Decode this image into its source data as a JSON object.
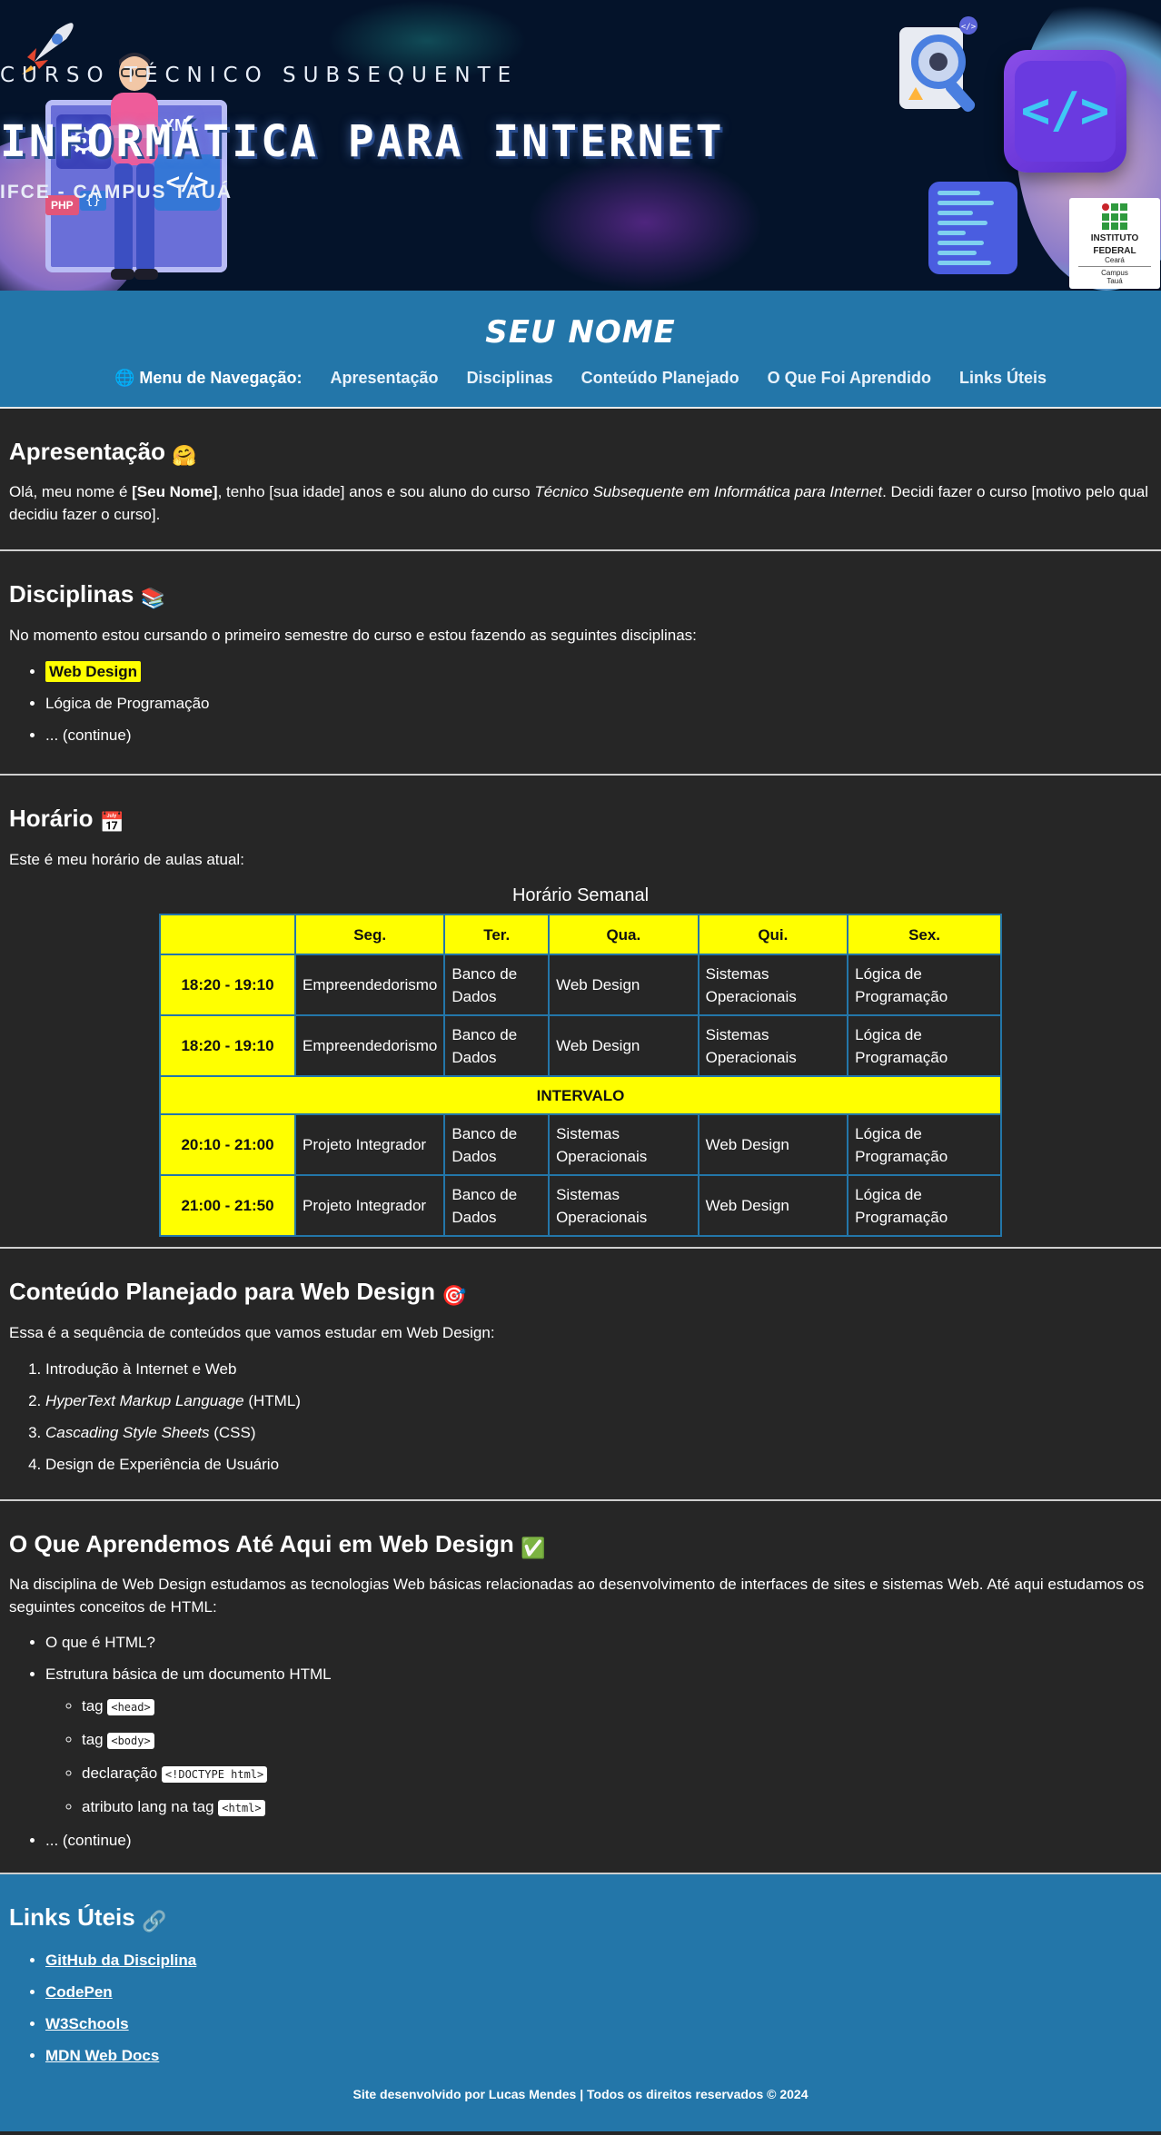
{
  "banner": {
    "kicker": "CURSO TÉCNICO SUBSEQUENTE",
    "title": "INFORMÁTICA PARA INTERNET",
    "subtitle": "IFCE - CAMPUS TAUÁ",
    "board_labels": {
      "xml": "XML",
      "php": "PHP",
      "braces": "{}",
      "code": "</>"
    },
    "logo": {
      "line1": "INSTITUTO",
      "line2": "FEDERAL",
      "line3": "Ceará",
      "line4": "Campus",
      "line5": "Tauá"
    }
  },
  "header": {
    "site_name": "SEU NOME",
    "nav_label": "Menu de Navegação:",
    "nav_items": [
      "Apresentação",
      "Disciplinas",
      "Conteúdo Planejado",
      "O Que Foi Aprendido",
      "Links Úteis"
    ]
  },
  "apresentacao": {
    "title": "Apresentação",
    "text_1": "Olá, meu nome é ",
    "name_bold": "[Seu Nome]",
    "text_2": ", tenho [sua idade] anos e sou aluno do curso ",
    "course_italic": "Técnico Subsequente em Informática para Internet",
    "text_3": ". Decidi fazer o curso [motivo pelo qual decidiu fazer o curso]."
  },
  "disciplinas": {
    "title": "Disciplinas",
    "intro": "No momento estou cursando o primeiro semestre do curso e estou fazendo as seguintes disciplinas:",
    "items": [
      "Web Design",
      "Lógica de Programação",
      "... (continue)"
    ]
  },
  "horario": {
    "title": "Horário",
    "intro": "Este é meu horário de aulas atual:",
    "caption": "Horário Semanal",
    "days": [
      "Seg.",
      "Ter.",
      "Qua.",
      "Qui.",
      "Sex."
    ],
    "break_label": "INTERVALO",
    "rows": [
      {
        "time": "18:20 - 19:10",
        "cells": [
          "Empreendedorismo",
          "Banco de Dados",
          "Web Design",
          "Sistemas Operacionais",
          "Lógica de Programação"
        ]
      },
      {
        "time": "18:20 - 19:10",
        "cells": [
          "Empreendedorismo",
          "Banco de Dados",
          "Web Design",
          "Sistemas Operacionais",
          "Lógica de Programação"
        ]
      },
      {
        "time": "20:10 - 21:00",
        "cells": [
          "Projeto Integrador",
          "Banco de Dados",
          "Sistemas Operacionais",
          "Web Design",
          "Lógica de Programação"
        ]
      },
      {
        "time": "21:00 - 21:50",
        "cells": [
          "Projeto Integrador",
          "Banco de Dados",
          "Sistemas Operacionais",
          "Web Design",
          "Lógica de Programação"
        ]
      }
    ]
  },
  "conteudo": {
    "title": "Conteúdo Planejado para Web Design",
    "intro": "Essa é a sequência de conteúdos que vamos estudar em Web Design:",
    "item1": "Introdução à Internet e Web",
    "item2_italic": "HyperText Markup Language",
    "item2_rest": " (HTML)",
    "item3_italic": "Cascading Style Sheets",
    "item3_rest": " (CSS)",
    "item4": "Design de Experiência de Usuário"
  },
  "aprendido": {
    "title": "O Que Aprendemos Até Aqui em Web Design",
    "intro": "Na disciplina de Web Design estudamos as tecnologias Web básicas relacionadas ao desenvolvimento de interfaces de sites e sistemas Web. Até aqui estudamos os seguintes conceitos de HTML:",
    "item1": "O que é HTML?",
    "item2": "Estrutura básica de um documento HTML",
    "sub": [
      {
        "text": "tag ",
        "code": "<head>"
      },
      {
        "text": "tag ",
        "code": "<body>"
      },
      {
        "text": "declaração ",
        "code": "<!DOCTYPE html>"
      },
      {
        "text": "atributo lang na tag ",
        "code": "<html>"
      }
    ],
    "item3": "... (continue)"
  },
  "links": {
    "title": "Links Úteis",
    "items": [
      "GitHub da Disciplina",
      "CodePen",
      "W3Schools",
      "MDN Web Docs"
    ],
    "footer": "Site desenvolvido por Lucas Mendes | Todos os direitos reservados © 2024"
  },
  "colors": {
    "header_blue": "#2376a9",
    "highlight_yellow": "#ffff00",
    "body_bg": "#262626",
    "banner_bg": "#04132a"
  },
  "icons": [
    "globe-icon",
    "hugging-face-emoji",
    "books-emoji",
    "calendar-emoji",
    "target-emoji",
    "check-mark-emoji",
    "link-emoji"
  ]
}
